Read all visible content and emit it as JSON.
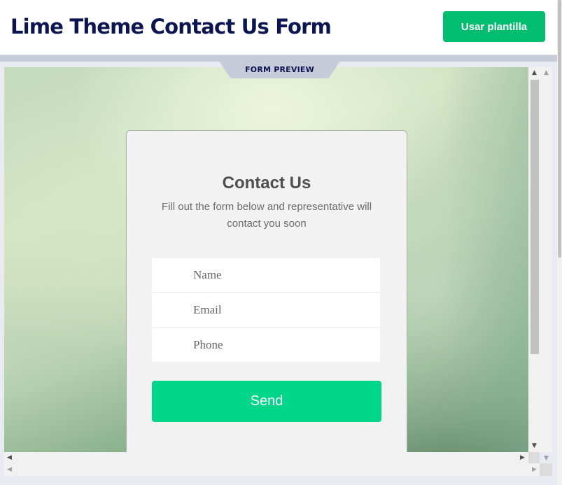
{
  "header": {
    "title": "Lime Theme Contact Us Form",
    "use_template_label": "Usar plantilla"
  },
  "preview": {
    "tab_label": "FORM PREVIEW"
  },
  "form": {
    "heading": "Contact Us",
    "subheading": "Fill out the form below and representative will contact you soon",
    "fields": [
      {
        "placeholder": "Name",
        "value": ""
      },
      {
        "placeholder": "Email",
        "value": ""
      },
      {
        "placeholder": "Phone",
        "value": ""
      }
    ],
    "send_label": "Send"
  },
  "scrollbar_icons": {
    "up": "▲",
    "down": "▼",
    "left": "◀",
    "right": "▶"
  },
  "colors": {
    "brand_navy": "#0a1551",
    "use_template_button": "#01bd6f",
    "send_button": "#00d689",
    "card_background": "#f2f2f2"
  }
}
